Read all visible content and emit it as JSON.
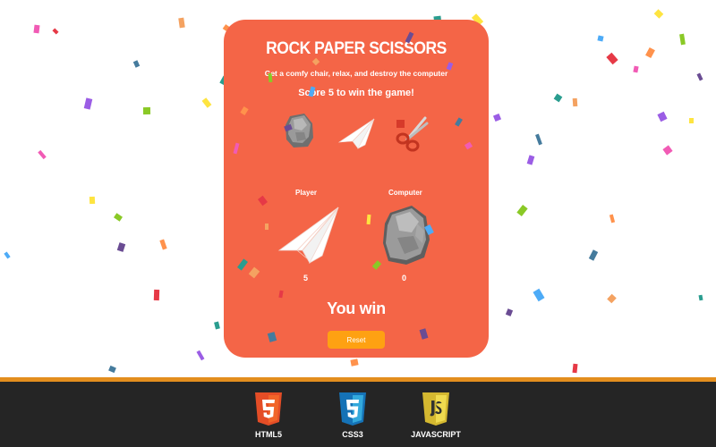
{
  "game": {
    "title": "ROCK PAPER SCISSORS",
    "subtitle": "Get a comfy chair, relax, and destroy the computer",
    "goal": "Score 5 to win the game!",
    "choices": [
      {
        "name": "rock",
        "icon": "rock-icon"
      },
      {
        "name": "paper",
        "icon": "paper-plane-icon"
      },
      {
        "name": "scissors",
        "icon": "scissors-icon"
      }
    ],
    "player": {
      "label": "Player",
      "choice": "paper",
      "score": "5"
    },
    "computer": {
      "label": "Computer",
      "choice": "rock",
      "score": "0"
    },
    "result": "You win",
    "reset_label": "Reset"
  },
  "footer": {
    "techs": [
      {
        "label": "HTML5",
        "icon": "html5-icon",
        "color": "#e44d26"
      },
      {
        "label": "CSS3",
        "icon": "css3-icon",
        "color": "#1572b6"
      },
      {
        "label": "JAVASCRIPT",
        "icon": "javascript-icon",
        "color": "#f0db4f"
      }
    ]
  },
  "colors": {
    "card": "#f46547",
    "button": "#fea112",
    "footer": "#252525",
    "footer_border": "#e38e1e"
  }
}
